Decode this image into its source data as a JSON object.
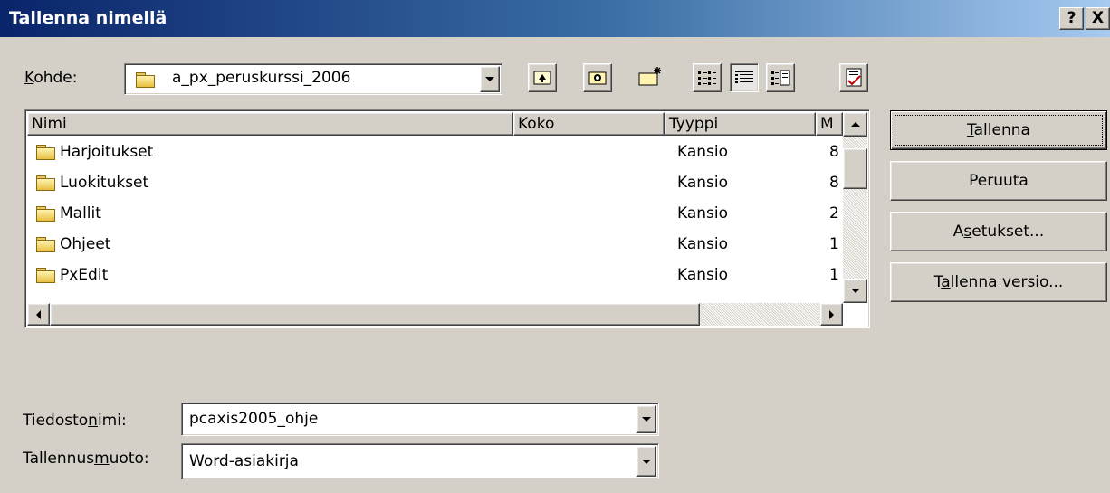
{
  "window": {
    "title": "Tallenna nimellä",
    "help_btn": "?",
    "close_btn": "X"
  },
  "location": {
    "label_prefix": "K",
    "label_rest": "ohde:",
    "value": "a_px_peruskurssi_2006"
  },
  "toolbar": {
    "icons": [
      "back-icon",
      "up-folder-icon",
      "search-web-icon",
      "new-folder-icon",
      "list-view-icon",
      "details-view-icon",
      "properties-view-icon",
      "tools-icon"
    ]
  },
  "list": {
    "columns": {
      "name": "Nimi",
      "size": "Koko",
      "type": "Tyyppi",
      "modified": "M"
    },
    "rows": [
      {
        "name": "Harjoitukset",
        "type": "Kansio",
        "mod": "8"
      },
      {
        "name": "Luokitukset",
        "type": "Kansio",
        "mod": "8"
      },
      {
        "name": "Mallit",
        "type": "Kansio",
        "mod": "2"
      },
      {
        "name": "Ohjeet",
        "type": "Kansio",
        "mod": "1"
      },
      {
        "name": "PxEdit",
        "type": "Kansio",
        "mod": "1"
      }
    ]
  },
  "filename": {
    "label_a": "Tiedosto",
    "label_u": "n",
    "label_b": "imi:",
    "value": "pcaxis2005_ohje"
  },
  "format": {
    "label_a": "Tallennus",
    "label_u": "m",
    "label_b": "uoto:",
    "value": "Word-asiakirja"
  },
  "buttons": {
    "save_u": "T",
    "save_rest": "allenna",
    "cancel": "Peruuta",
    "options_a": "A",
    "options_u": "s",
    "options_b": "etukset...",
    "saveversion_a": "T",
    "saveversion_u": "a",
    "saveversion_b": "llenna versio..."
  }
}
